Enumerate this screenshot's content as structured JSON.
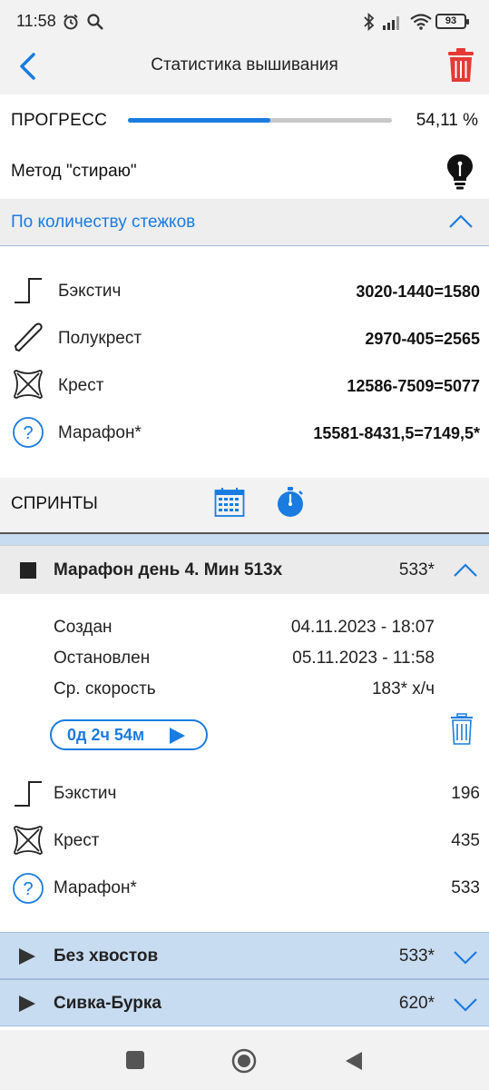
{
  "status_bar": {
    "time": "11:58",
    "battery": "93"
  },
  "header": {
    "title": "Статистика вышивания"
  },
  "progress": {
    "label": "ПРОГРЕСС",
    "value_text": "54,11 %",
    "fraction": 0.5411
  },
  "method": {
    "label": "Метод \"стираю\""
  },
  "stitch_section": {
    "title": "По количеству стежков",
    "rows": [
      {
        "label": "Бэкстич",
        "value": "3020-1440=1580",
        "icon": "backstitch-icon"
      },
      {
        "label": "Полукрест",
        "value": "2970-405=2565",
        "icon": "half-cross-icon"
      },
      {
        "label": "Крест",
        "value": "12586-7509=5077",
        "icon": "cross-icon"
      },
      {
        "label": "Марафон*",
        "value": "15581-8431,5=7149,5*",
        "icon": "question-icon"
      }
    ]
  },
  "sprints": {
    "title": "СПРИНТЫ"
  },
  "sprint_active": {
    "name": "Марафон день 4. Мин 513х",
    "count": "533*",
    "info": [
      {
        "label": "Создан",
        "value": "04.11.2023 - 18:07"
      },
      {
        "label": "Остановлен",
        "value": "05.11.2023 - 11:58"
      },
      {
        "label": "Ср. скорость",
        "value": "183* х/ч"
      }
    ],
    "timer": "0д 2ч 54м",
    "rows": [
      {
        "label": "Бэкстич",
        "value": "196",
        "icon": "backstitch-icon"
      },
      {
        "label": "Крест",
        "value": "435",
        "icon": "cross-icon"
      },
      {
        "label": "Марафон*",
        "value": "533",
        "icon": "question-icon"
      }
    ]
  },
  "sprints_collapsed": [
    {
      "name": "Без хвостов",
      "count": "533*"
    },
    {
      "name": "Сивка-Бурка",
      "count": "620*"
    }
  ],
  "colors": {
    "accent": "#1a7be0",
    "delete": "#e53935",
    "collapsed_bg": "#c8dcf1"
  }
}
